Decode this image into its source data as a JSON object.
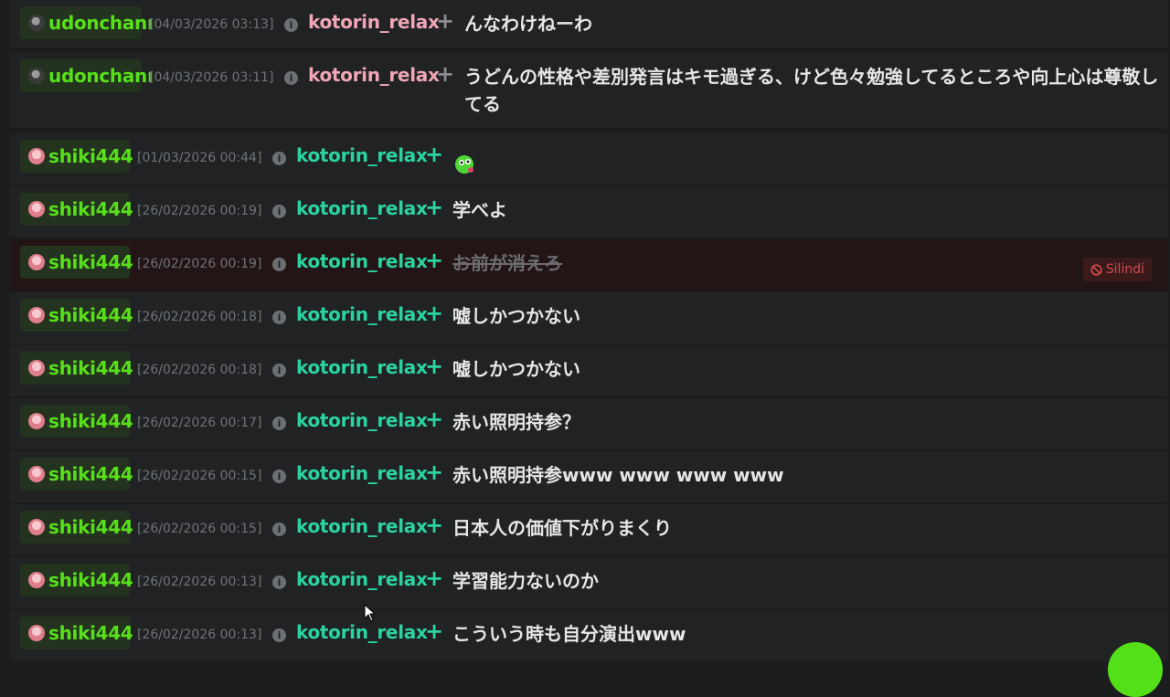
{
  "colors": {
    "kick_green": "#57e01a",
    "target_pink": "#f0a6b5",
    "target_teal": "#2ad3a0",
    "deleted_red": "#d24b4b"
  },
  "rows": [
    {
      "sender": "udonchanı",
      "avatar": "dark-avatar",
      "time": "[04/03/2026 03:13]",
      "target": "kotorin_relax",
      "target_color": "#f0a6b5",
      "message": "んなわけねーわ",
      "deleted": false
    },
    {
      "sender": "udonchanı",
      "avatar": "dark-avatar",
      "time": "[04/03/2026 03:11]",
      "target": "kotorin_relax",
      "target_color": "#f0a6b5",
      "message": "うどんの性格や差別発言はキモ過ぎる、けど色々勉強してるところや向上心は尊敬してる",
      "deleted": false
    },
    {
      "sender": "shiki444",
      "avatar": "pink-avatar",
      "time": "[01/03/2026 00:44]",
      "target": "kotorin_relax",
      "target_color": "#2ad3a0",
      "message": "",
      "emoji": "green-creature-emote",
      "deleted": false
    },
    {
      "sender": "shiki444",
      "avatar": "pink-avatar",
      "time": "[26/02/2026 00:19]",
      "target": "kotorin_relax",
      "target_color": "#2ad3a0",
      "message": "学べよ",
      "deleted": false
    },
    {
      "sender": "shiki444",
      "avatar": "pink-avatar",
      "time": "[26/02/2026 00:19]",
      "target": "kotorin_relax",
      "target_color": "#2ad3a0",
      "message": "お前が消えろ",
      "deleted": true
    },
    {
      "sender": "shiki444",
      "avatar": "pink-avatar",
      "time": "[26/02/2026 00:18]",
      "target": "kotorin_relax",
      "target_color": "#2ad3a0",
      "message": "嘘しかつかない",
      "deleted": false
    },
    {
      "sender": "shiki444",
      "avatar": "pink-avatar",
      "time": "[26/02/2026 00:18]",
      "target": "kotorin_relax",
      "target_color": "#2ad3a0",
      "message": "嘘しかつかない",
      "deleted": false
    },
    {
      "sender": "shiki444",
      "avatar": "pink-avatar",
      "time": "[26/02/2026 00:17]",
      "target": "kotorin_relax",
      "target_color": "#2ad3a0",
      "message": "赤い照明持参？",
      "deleted": false
    },
    {
      "sender": "shiki444",
      "avatar": "pink-avatar",
      "time": "[26/02/2026 00:15]",
      "target": "kotorin_relax",
      "target_color": "#2ad3a0",
      "message": "赤い照明持参www www www www",
      "deleted": false
    },
    {
      "sender": "shiki444",
      "avatar": "pink-avatar",
      "time": "[26/02/2026 00:15]",
      "target": "kotorin_relax",
      "target_color": "#2ad3a0",
      "message": "日本人の価値下がりまくり",
      "deleted": false
    },
    {
      "sender": "shiki444",
      "avatar": "pink-avatar",
      "time": "[26/02/2026 00:13]",
      "target": "kotorin_relax",
      "target_color": "#2ad3a0",
      "message": "学習能力ないのか",
      "deleted": false
    },
    {
      "sender": "shiki444",
      "avatar": "pink-avatar",
      "time": "[26/02/2026 00:13]",
      "target": "kotorin_relax",
      "target_color": "#2ad3a0",
      "message": "こういう時も自分演出www",
      "deleted": false
    }
  ],
  "deleted_badge": {
    "label": "Silindi",
    "icon": "prohibited-icon"
  },
  "info_icon": "info-icon",
  "plus_glyph": "+"
}
